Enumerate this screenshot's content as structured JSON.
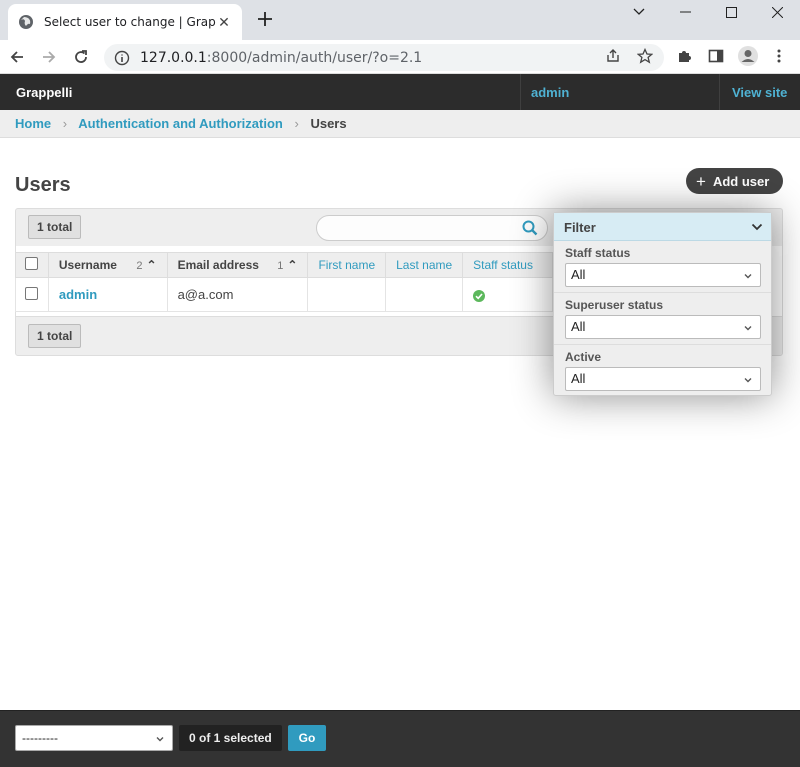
{
  "browser": {
    "tab_title": "Select user to change | Grappelli",
    "url_host": "127.0.0.1",
    "url_path": ":8000/admin/auth/user/?o=2.1",
    "icons": [
      "globe-icon",
      "close-icon",
      "plus-icon",
      "minimize-icon",
      "maximize-icon",
      "close-window-icon",
      "back-icon",
      "forward-icon",
      "reload-icon",
      "info-icon",
      "share-icon",
      "star-icon",
      "extensions-icon",
      "sidepanel-icon",
      "profile-icon",
      "menu-icon"
    ]
  },
  "header": {
    "brand": "Grappelli",
    "user": "admin",
    "view_site": "View site"
  },
  "breadcrumbs": {
    "home": "Home",
    "section": "Authentication and Authorization",
    "current": "Users"
  },
  "page": {
    "title": "Users",
    "add_label": "Add user",
    "total_top": "1 total",
    "total_bottom": "1 total"
  },
  "table": {
    "columns": {
      "username": "Username",
      "username_sort": "2",
      "email": "Email address",
      "email_sort": "1",
      "first_name": "First name",
      "last_name": "Last name",
      "staff_status": "Staff status"
    },
    "rows": [
      {
        "username": "admin",
        "email": "a@a.com",
        "first_name": "",
        "last_name": "",
        "staff_status": true
      }
    ]
  },
  "filter": {
    "title": "Filter",
    "sections": [
      {
        "label": "Staff status",
        "value": "All"
      },
      {
        "label": "Superuser status",
        "value": "All"
      },
      {
        "label": "Active",
        "value": "All"
      }
    ]
  },
  "actions": {
    "select_value": "---------",
    "selected_counter": "0 of 1 selected",
    "go_label": "Go"
  },
  "colors": {
    "accent": "#309bbf",
    "header_bg": "#2c2c2c",
    "success": "#5cb85c"
  }
}
